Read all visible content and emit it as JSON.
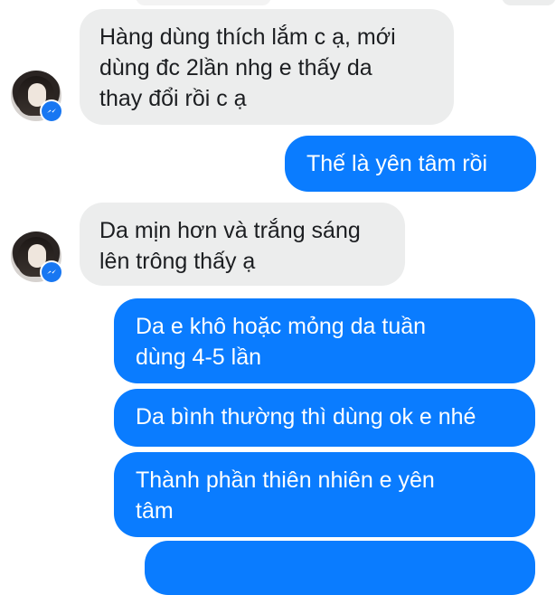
{
  "messages": [
    {
      "side": "in",
      "text": "Hàng dùng thích lắm c ạ, mới\ndùng đc 2lần nhg e thấy da\nthay đổi rồi c ạ"
    },
    {
      "side": "out",
      "text": "Thế là yên tâm rồi"
    },
    {
      "side": "in",
      "text": "Da mịn hơn và trắng sáng\nlên trông thấy ạ"
    },
    {
      "side": "out",
      "text": "Da e khô hoặc mỏng da tuần\ndùng 4-5 lần"
    },
    {
      "side": "out",
      "text": "Da bình thường thì dùng ok e nhé"
    },
    {
      "side": "out",
      "text": "Thành phần thiên nhiên e yên\ntâm"
    }
  ],
  "colors": {
    "incoming_bubble": "#eceded",
    "outgoing_bubble": "#0a7cff",
    "messenger_badge": "#1877f2"
  },
  "icons": {
    "avatar_badge": "messenger-icon"
  }
}
